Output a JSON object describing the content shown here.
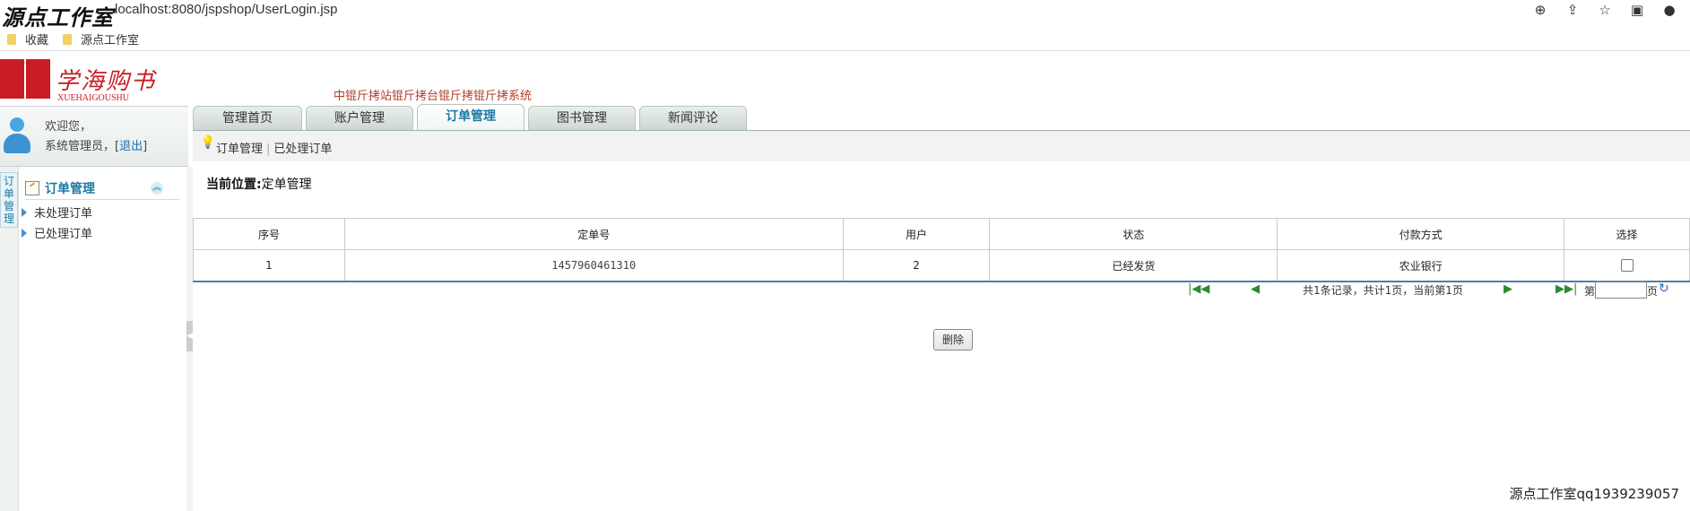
{
  "browser": {
    "watermark": "源点工作室",
    "url": "localhost:8080/jspshop/UserLogin.jsp",
    "icons": [
      "zoom-icon",
      "share-icon",
      "star-icon",
      "sidebar-icon",
      "profile-icon"
    ],
    "bookmarks": [
      "收藏",
      "源点工作室"
    ]
  },
  "header": {
    "logo_text": "学海购书",
    "logo_sub": "XUEHAIGOUSHU",
    "system_title": "中锟斤拷站锟斤拷台锟斤拷锟斤拷系统"
  },
  "tabs": [
    {
      "label": "管理首页",
      "active": false
    },
    {
      "label": "账户管理",
      "active": false
    },
    {
      "label": "订单管理",
      "active": true
    },
    {
      "label": "图书管理",
      "active": false
    },
    {
      "label": "新闻评论",
      "active": false
    }
  ],
  "subbar": {
    "item1": "订单管理",
    "item2": "已处理订单"
  },
  "user": {
    "welcome": "欢迎您，",
    "role": "系统管理员，[",
    "logout": "退出",
    "close_bracket": "]"
  },
  "sidebar": {
    "vertical_tab": "订单管理",
    "menu_title": "订单管理",
    "items": [
      {
        "label": "未处理订单"
      },
      {
        "label": "已处理订单"
      }
    ]
  },
  "location": {
    "label": "当前位置:",
    "value": "定单管理"
  },
  "table": {
    "headers": [
      "序号",
      "定单号",
      "用户",
      "状态",
      "付款方式",
      "选择"
    ],
    "rows": [
      {
        "no": "1",
        "order_no": "1457960461310",
        "user": "2",
        "status": "已经发货",
        "payment": "农业银行",
        "selected": false
      }
    ]
  },
  "pager": {
    "info": "共1条记录，共计1页，当前第1页",
    "prefix": "第",
    "suffix": "页"
  },
  "actions": {
    "delete": "删除"
  },
  "footer": {
    "watermark": "源点工作室qq1939239057"
  }
}
